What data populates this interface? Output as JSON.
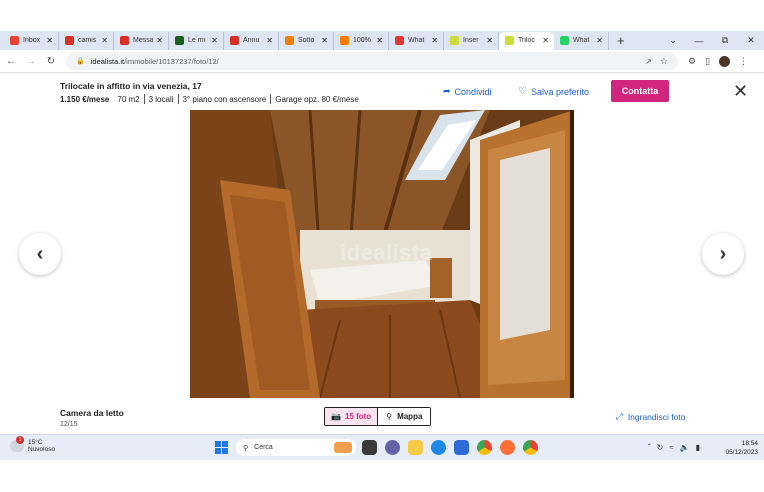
{
  "browser": {
    "tabs": [
      {
        "label": "Inbox",
        "icon": "gmail-icon",
        "color": "#ea4335"
      },
      {
        "label": "camis",
        "icon": "red-circle-icon",
        "color": "#d93025"
      },
      {
        "label": "Messa",
        "icon": "red-circle-icon",
        "color": "#d93025"
      },
      {
        "label": "Le mi",
        "icon": "dark-square-icon",
        "color": "#1b5e20"
      },
      {
        "label": "Annu",
        "icon": "red-circle-icon",
        "color": "#d93025"
      },
      {
        "label": "Sotto",
        "icon": "orange-square-icon",
        "color": "#f57c00"
      },
      {
        "label": "100%",
        "icon": "orange-square-icon",
        "color": "#f57c00"
      },
      {
        "label": "What",
        "icon": "red-info-icon",
        "color": "#e53935"
      },
      {
        "label": "Inser",
        "icon": "idealista-icon",
        "color": "#cddc39"
      },
      {
        "label": "Triloc",
        "icon": "idealista-icon",
        "color": "#cddc39",
        "active": true
      },
      {
        "label": "What",
        "icon": "whatsapp-icon",
        "color": "#25d366"
      }
    ],
    "new_tab": "+",
    "window_controls": {
      "dropdown": "⌄",
      "minimize": "—",
      "restore": "⧉",
      "close": "✕"
    },
    "url_domain": "idealista.it",
    "url_path": "/immobile/10137237/foto/12/"
  },
  "listing": {
    "title": "Trilocale in affitto in via venezia, 17",
    "price": "1.150 €/mese",
    "area": "70 m2",
    "rooms": "3 locali",
    "floor": "3° piano con ascensore",
    "garage": "Garage opz. 80 €/mese",
    "share_label": "Condividi",
    "favorite_label": "Salva preferito",
    "contact_label": "Contatta",
    "close_label": "✕"
  },
  "photo": {
    "watermark": "idealista",
    "caption": "Camera da letto",
    "counter": "12/15",
    "photos_tab": "15 foto",
    "map_tab": "Mappa",
    "enlarge_label": "Ingrandisci foto",
    "prev": "‹",
    "next": "›"
  },
  "taskbar": {
    "temperature": "15°C",
    "weather": "Nuvoloso",
    "notification_count": "1",
    "search_placeholder": "Cerca",
    "time": "18:54",
    "date": "05/12/2023"
  },
  "colors": {
    "accent": "#d0267e",
    "link": "#1c5ed1"
  }
}
